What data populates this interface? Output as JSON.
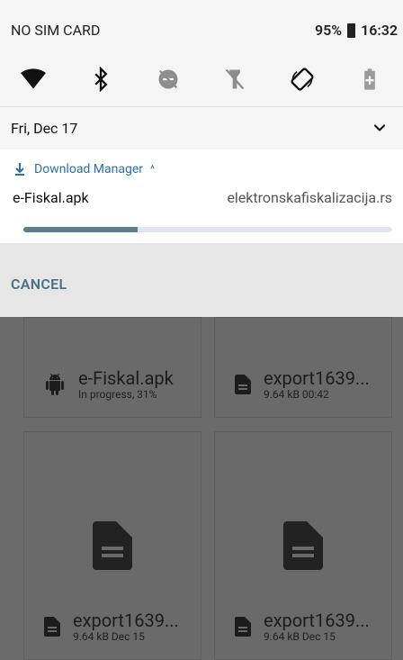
{
  "status_bar": {
    "carrier": "NO SIM CARD",
    "battery": "95%",
    "time": "16:32"
  },
  "quick_settings": {
    "icons": [
      "wifi-icon",
      "bluetooth-icon",
      "dnd-off-icon",
      "flashlight-off-icon",
      "auto-rotate-icon",
      "battery-saver-icon"
    ]
  },
  "shade": {
    "date": "Fri, Dec 17"
  },
  "notification": {
    "app_name": "Download Manager",
    "expand_caret": "^",
    "title": "e-Fiskal.apk",
    "site": "elektronskafiskalizacija.rs",
    "progress": 0.31,
    "accent": "#607d8b"
  },
  "actions": {
    "cancel": "CANCEL"
  },
  "downloads": [
    {
      "title": "e-Fiskal.apk",
      "sub": "In progress, 31%",
      "icon": "android-icon"
    },
    {
      "title": "export1639...",
      "sub": "9.64 kB 00:42",
      "icon": "document-icon"
    },
    {
      "title": "export1639...",
      "sub": "9.64 kB Dec 15",
      "icon": "document-icon"
    },
    {
      "title": "export1639...",
      "sub": "9.64 kB Dec 15",
      "icon": "document-icon"
    }
  ]
}
